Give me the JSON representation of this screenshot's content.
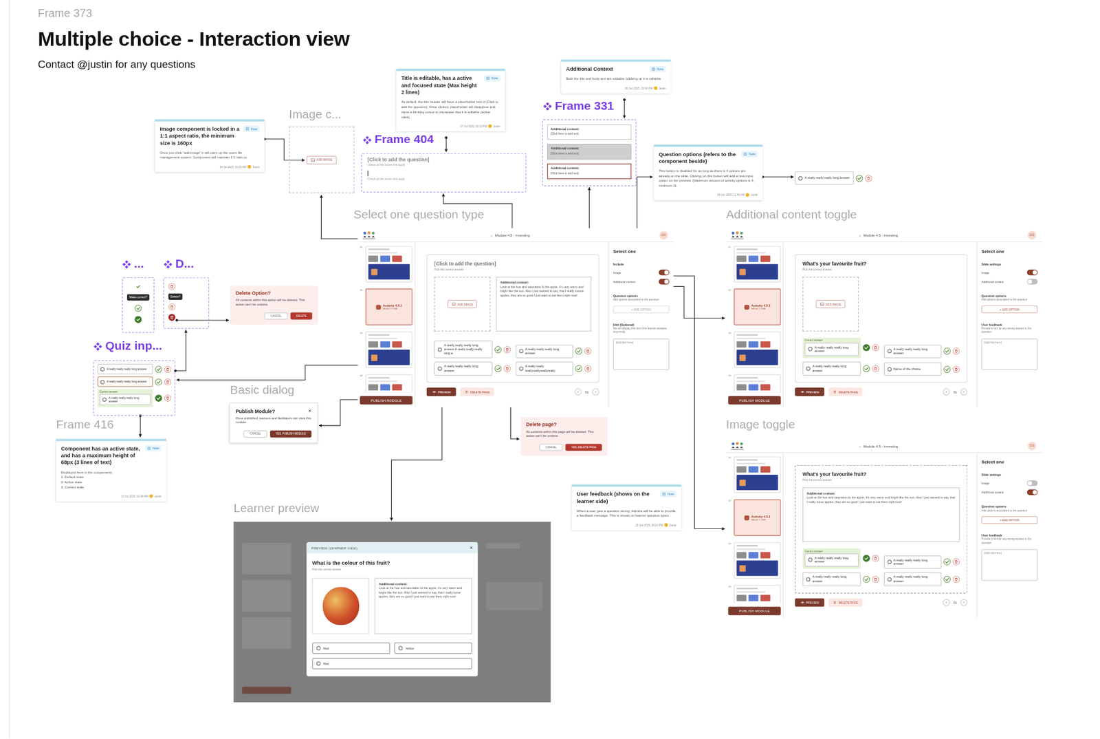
{
  "header": {
    "frame": "Frame 373",
    "title": "Multiple choice - Interaction view",
    "contact": "Contact @justin for any questions"
  },
  "labels": [
    {
      "text": "Image c...",
      "kind": "frame"
    },
    {
      "text": "Frame 404",
      "kind": "component"
    },
    {
      "text": "Frame 331",
      "kind": "component"
    },
    {
      "text": "...",
      "kind": "component"
    },
    {
      "text": "D...",
      "kind": "component"
    },
    {
      "text": "Quiz inp...",
      "kind": "component"
    },
    {
      "text": "Basic dialog",
      "kind": "frame"
    },
    {
      "text": "Frame 416",
      "kind": "frame"
    },
    {
      "text": "Select one question type",
      "kind": "frame"
    },
    {
      "text": "Additional content toggle",
      "kind": "frame"
    },
    {
      "text": "Image toggle",
      "kind": "frame"
    },
    {
      "text": "Learner preview",
      "kind": "frame"
    }
  ],
  "notes": [
    {
      "title": "Image component is locked in a 1:1 aspect ratio, the minimum size is 160px",
      "badge": "Note",
      "body": "Once you click \"add image\" it will open up the users file management system. Component will maintain 1:1 ratio.cc",
      "date": "04 Jul 2025, 01:50 AM",
      "author": "Justin"
    },
    {
      "title": "Title is editable, has a active and focused state (Max height 2 lines)",
      "badge": "Note",
      "body": "As default, the title header will have a placeholder text of [Click to add the question]. Once clicked, placeholder will disappear and show a blinking cursor to showcase that it is editable (active state).",
      "date": "07 Jul 2025, 06:10 PM",
      "author": "Justin"
    },
    {
      "title": "Additional Context",
      "badge": "Note",
      "body": "Both the title and body text are editable (clicking on it is editable",
      "date": "06 Jun 2025, 03:34 PM",
      "author": "Justin"
    },
    {
      "title": "Question options (refers to the component beside)",
      "badge": "Note",
      "body": "This button is disabled for as long as there is 4 options are already on the slide. Clicking on this button will add a new input option on the preview. (Maximum amount of activity options is 4, minimum 2).",
      "date": "08 Jun 2025, 11:49 AM",
      "author": "Justin"
    },
    {
      "title": "Component has an active state, and has a maximum height of 68px (3 lines of text)",
      "badge": "Note",
      "body": "Displayed here in the components:\n1. Default state\n2. Active state\n3. Correct state",
      "date": "03 Jul 2025, 01:48 PM",
      "author": "Justin"
    },
    {
      "title": "User feedback (shows on the learner side)",
      "badge": "Note",
      "body": "When a user gets a question wrong, Admins will be able to provide a feedback message. This is shown on learner question types.",
      "date": "23 Jun 2025, 06:10 PM",
      "author": "Justin"
    }
  ],
  "imageFrame": {
    "button": "ADD IMAGE"
  },
  "titleFrame": {
    "states": [
      {
        "kind": "default",
        "title": "[Click to add the question]",
        "sub": "Check all the boxes that apply"
      },
      {
        "kind": "active",
        "title": "",
        "sub": "Check all the boxes that apply"
      }
    ]
  },
  "contextFrame": {
    "states": [
      {
        "kind": "default",
        "label": "Additional context:",
        "placeholder": "[Click here to add text]"
      },
      {
        "kind": "hover",
        "label": "Additional context:",
        "placeholder": "[Click here to add text]"
      },
      {
        "kind": "active",
        "label": "Additional context:",
        "placeholder": "[Click here to add text]"
      }
    ]
  },
  "correctFrame": {
    "tooltip": "Make correct?",
    "states": [
      {
        "kind": "plain"
      },
      {
        "kind": "outlined"
      },
      {
        "kind": "filled"
      }
    ]
  },
  "deleteFrame": {
    "tooltip": "Delete?",
    "states": [
      {
        "kind": "outlined"
      },
      {
        "kind": "outlined"
      },
      {
        "kind": "filled"
      }
    ]
  },
  "quizFrame": {
    "options": [
      {
        "text": "A really really really long answer",
        "correct": false,
        "active": false
      },
      {
        "text": "A really really really long answer",
        "correct": false,
        "active": true
      },
      {
        "text": "A really really really long answer",
        "correct": true,
        "active": false,
        "label": "Correct answer"
      }
    ]
  },
  "noteOption": {
    "text": "A really really really long answer",
    "correct": false,
    "active": false
  },
  "dialogs": [
    {
      "kind": "warning",
      "title": "Delete Option?",
      "body": "All contents within this option will be deleted. This action can't be undone.",
      "cancel": "CANCEL",
      "confirm": "DELETE"
    },
    {
      "kind": "basic",
      "title": "Publish Module?",
      "close": "×",
      "body": "Once published, learners and facilitators can view this module.",
      "cancel": "CANCEL",
      "confirm": "YES, PUBLISH MODULE"
    },
    {
      "kind": "warning",
      "title": "Delete page?",
      "body": "All contents within this page will be deleted. This action can't be undone.",
      "cancel": "CANCEL",
      "confirm": "YES, DELETE PAGE"
    }
  ],
  "screens": [
    {
      "back": "‹",
      "module": "Module 4.5 - Investing",
      "avatar": "GS",
      "slides": [
        {
          "num": "01",
          "kind": "content",
          "selected": false
        },
        {
          "num": "02",
          "kind": "activity",
          "selected": true,
          "title": "Activity 4.5.1",
          "sub": "SELECT ONE"
        },
        {
          "num": "03",
          "kind": "content",
          "selected": false
        },
        {
          "num": "04",
          "kind": "content",
          "selected": false
        }
      ],
      "publish": "PUBLISH MODULE",
      "focused": false,
      "question": {
        "text": "[Click to add the question]",
        "placeholder": true,
        "sub": "Pick the correct answer"
      },
      "image": {
        "show": true,
        "button": "ADD IMAGE"
      },
      "context": {
        "show": true,
        "label": "Additional context:",
        "text": "Look at the hue and saturation fo the apple, it's very warm and bright like the sun. Also I just wanted to say, that I really looove apples, they are so good I just want to eat them right now!"
      },
      "options": [
        {
          "text": "A really really really long answer A really really really long a",
          "correct": false,
          "active": false
        },
        {
          "text": "A really really really long answer",
          "correct": false,
          "active": false
        },
        {
          "text": "A really really really long answer",
          "correct": false,
          "active": false
        },
        {
          "text": "A really really reallyreallyreallyreally",
          "correct": false,
          "active": false
        }
      ],
      "preview": "PREVIEW",
      "deletePage": "DELETE PAGE",
      "prev": "‹",
      "page": "01",
      "next": "›",
      "panel": {
        "title": "Select one",
        "settings": "Include",
        "toggles": [
          {
            "label": "Image",
            "on": true
          },
          {
            "label": "Additional context",
            "on": true
          }
        ],
        "optionsTitle": "Question options",
        "optionsDesc": "Add options associated to the question",
        "addOption": {
          "label": "+ ADD OPTION",
          "disabled": true
        },
        "feedbackTitle": "Hint (Optional)",
        "feedbackDesc": "We will display this hint if the learner answers incorrectly",
        "feedbackPlaceholder": "[Add hint here]"
      }
    },
    {
      "back": "‹",
      "module": "Module 4.5 - Investing",
      "avatar": "GS",
      "slides": [
        {
          "num": "01",
          "kind": "content",
          "selected": false
        },
        {
          "num": "02",
          "kind": "activity",
          "selected": true,
          "title": "Activity 4.5.1",
          "sub": "SELECT ONE"
        },
        {
          "num": "03",
          "kind": "content",
          "selected": false
        },
        {
          "num": "04",
          "kind": "content",
          "selected": false
        }
      ],
      "publish": "PUBLISH MODULE",
      "focused": false,
      "question": {
        "text": "What's your favourite fruit?",
        "placeholder": false,
        "sub": "Pick the correct answer"
      },
      "image": {
        "show": true,
        "button": "ADD IMAGE"
      },
      "context": {
        "show": false,
        "label": "",
        "text": ""
      },
      "options": [
        {
          "text": "A really really really long answer",
          "correct": true,
          "active": false,
          "label": "Correct answer"
        },
        {
          "text": "A really really really long answer",
          "correct": false,
          "active": false
        },
        {
          "text": "A really really really long answer",
          "correct": false,
          "active": false
        },
        {
          "text": "Name of the choice",
          "correct": false,
          "active": false
        }
      ],
      "preview": "PREVIEW",
      "deletePage": "DELETE PAGE",
      "prev": "‹",
      "page": "01",
      "next": "›",
      "panel": {
        "title": "Select one",
        "settings": "Slide settings",
        "toggles": [
          {
            "label": "Image",
            "on": true
          },
          {
            "label": "Additional context",
            "on": false
          }
        ],
        "optionsTitle": "Question options",
        "optionsDesc": "Add options associated to the question",
        "addOption": {
          "label": "+ ADD OPTION",
          "disabled": false
        },
        "feedbackTitle": "User feedback",
        "feedbackDesc": "Provide a hint for any wrong answer to the question",
        "feedbackPlaceholder": "[Add hint here]"
      }
    },
    {
      "back": "‹",
      "module": "Module 4.5 - Investing",
      "avatar": "GS",
      "slides": [
        {
          "num": "01",
          "kind": "content",
          "selected": false
        },
        {
          "num": "02",
          "kind": "activity",
          "selected": true,
          "title": "Activity 4.5.1",
          "sub": "SELECT ONE"
        },
        {
          "num": "03",
          "kind": "content",
          "selected": false
        },
        {
          "num": "04",
          "kind": "content",
          "selected": false
        }
      ],
      "publish": "PUBLISH MODULE",
      "focused": true,
      "question": {
        "text": "What's your favourite fruit?",
        "placeholder": false,
        "sub": "Pick the correct answer"
      },
      "image": {
        "show": false,
        "button": ""
      },
      "context": {
        "show": true,
        "label": "Additional context:",
        "text": "Look at the hue and saturation fo the apple, it's very warm and bright like the sun. Also I just wanted to say, that I really loove apples, they are so good I just want to eat them right now!"
      },
      "options": [
        {
          "text": "A really really really long answer",
          "correct": true,
          "active": false,
          "label": "Correct answer"
        },
        {
          "text": "A really really really long answer",
          "correct": false,
          "active": false
        },
        {
          "text": "A really really really long answer",
          "correct": false,
          "active": false
        },
        {
          "text": "A really really really long answer",
          "correct": false,
          "active": false
        }
      ],
      "preview": "PREVIEW",
      "deletePage": "DELETE PAGE",
      "prev": "‹",
      "page": "01",
      "next": "›",
      "panel": {
        "title": "Select one",
        "settings": "Slide settings",
        "toggles": [
          {
            "label": "Image",
            "on": false
          },
          {
            "label": "Additional context",
            "on": true
          }
        ],
        "optionsTitle": "Question options",
        "optionsDesc": "Add options associated to the question",
        "addOption": {
          "label": "+ ADD OPTION",
          "disabled": false
        },
        "feedbackTitle": "User feedback",
        "feedbackDesc": "Provide a hint for any wrong answer to the question",
        "feedbackPlaceholder": "[Add hint here]"
      }
    }
  ],
  "learnerPreview": {
    "header": "PREVIEW (LEARNER VIEW)",
    "close": "×",
    "question": "What is the colour of this fruit?",
    "sub": "Pick the correct answer",
    "contextLabel": "Additional context:",
    "contextText": "Look at the hue and saturation fo the apple, it's very warm and bright like the sun. Also I just wanted to say, that I really loove apples, they are so good I just want to eat them right now!",
    "options": [
      {
        "text": "Red",
        "selected": false
      },
      {
        "text": "Yellow",
        "selected": false
      },
      {
        "text": "Red",
        "selected": false
      }
    ]
  }
}
